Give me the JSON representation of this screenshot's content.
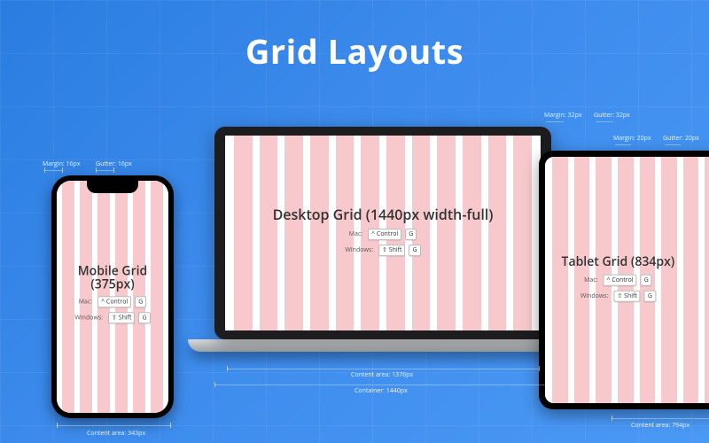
{
  "title": "Grid Layouts",
  "labels": {
    "mac": "Mac:",
    "windows": "Windows:",
    "key_control": "^ Control",
    "key_shift": "⇧ Shift",
    "key_g": "G"
  },
  "devices": {
    "mobile": {
      "title_line1": "Mobile Grid",
      "title_line2": "(375px)",
      "columns": 6,
      "margin_label": "Margin: 16px",
      "gutter_label": "Gutter: 16px",
      "content_area_label": "Content area: 343px"
    },
    "desktop": {
      "title": "Desktop Grid (1440px width-full)",
      "columns": 12,
      "margin_label": "Margin: 32px",
      "gutter_label": "Gutter: 32px",
      "content_area_label": "Content area: 1376px",
      "container_label": "Container: 1440px"
    },
    "tablet": {
      "title": "Tablet Grid (834px)",
      "columns": 8,
      "margin_label": "Margin: 20px",
      "gutter_label": "Gutter: 20px",
      "content_area_label": "Content area: 794px"
    }
  }
}
